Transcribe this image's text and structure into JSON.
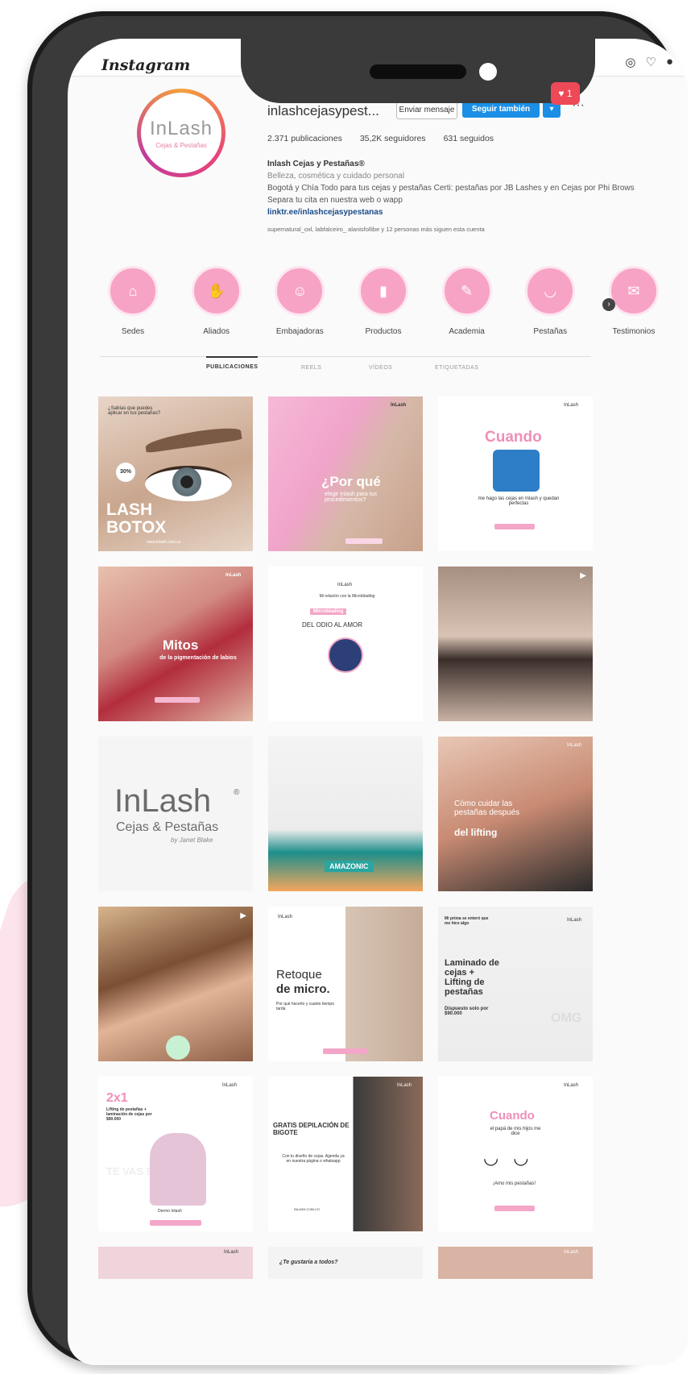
{
  "app": {
    "logo": "Instagram",
    "notification_count": "♥ 1"
  },
  "profile": {
    "avatar_logo": "InLash",
    "avatar_sub": "Cejas & Pestañas",
    "username": "inlashcejasypest...",
    "message_button": "Enviar mensaje",
    "follow_button": "Seguir también",
    "dropdown": "▾",
    "more": "···",
    "stats": {
      "posts": "2.371 publicaciones",
      "followers": "35,2K seguidores",
      "following": "631 seguidos"
    },
    "bio": {
      "name": "Inlash Cejas y Pestañas®",
      "category": "Belleza, cosmética y cuidado personal",
      "text": "Bogotá y Chía Todo para tus cejas y pestañas Certi: pestañas por JB Lashes y en Cejas por Phi Brows Separa tu cita en nuestra web o wapp",
      "link": "linktr.ee/inlashcejasypestanas",
      "followed_by": "supernatural_oxl, labfalceiro_ alanisfollibe y 12 personas más siguen esta cuenta"
    }
  },
  "highlights": [
    {
      "label": "Sedes",
      "icon": "chair-icon"
    },
    {
      "label": "Aliados",
      "icon": "handshake-icon"
    },
    {
      "label": "Embajadoras",
      "icon": "people-icon"
    },
    {
      "label": "Productos",
      "icon": "product-icon"
    },
    {
      "label": "Academia",
      "icon": "brush-icon"
    },
    {
      "label": "Pestañas",
      "icon": "lash-icon"
    },
    {
      "label": "Testimonios",
      "icon": "testimony-icon"
    }
  ],
  "tabs": [
    "PUBLICACIONES",
    "REELS",
    "VÍDEOS",
    "ETIQUETADAS"
  ],
  "posts": {
    "lash_botox": {
      "title": "LASH BOTOX",
      "top": "¿Sabías que puedes aplicar en tus pestañas?",
      "badge": "30%",
      "site": "www.inlash.com.co"
    },
    "por_que": {
      "title": "¿Por qué",
      "sub": "elegir Inlash para tus procedimientos?",
      "brand": "InLash"
    },
    "cuando1": {
      "title": "Cuando",
      "sub": "me hago las cejas en Inlash y quedan perfectas",
      "brand": "InLash"
    },
    "mitos": {
      "title": "Mitos",
      "sub": "de la pigmentación de labios",
      "brand": "InLash"
    },
    "odio": {
      "pre": "Mi relación con la Microblading",
      "tag": "Microblading",
      "title": "DEL ODIO AL AMOR",
      "brand": "InLash"
    },
    "logo": {
      "main": "InLash",
      "reg": "®",
      "sub": "Cejas & Pestañas",
      "by": "by Janet Blake"
    },
    "amazonic": {
      "title": "AMAZONIC"
    },
    "lifting": {
      "title": "Cómo cuidar las pestañas después",
      "bold": "del lifting",
      "brand": "InLash"
    },
    "retoque": {
      "title": "Retoque",
      "bold": "de micro.",
      "sub": "Por qué hacerlo y cuanto tiempo tarda",
      "brand": "InLash"
    },
    "laminado": {
      "pre": "Mi prima se enteró que me hice algo",
      "title": "Laminado de cejas + Lifting de pestañas",
      "price": "Dispuesto solo por $90.000",
      "omg": "OMG",
      "brand": "InLash"
    },
    "dos_x_uno": {
      "title": "2x1",
      "sub": "Lifting de pestañas + laminación de cejas por $90.000",
      "pattern": "TE VAS BELLA",
      "cta": "Dermo Inlash",
      "brand": "InLash"
    },
    "gratis": {
      "title": "GRATIS DEPILACIÓN DE BIGOTE",
      "sub": "Con tu diseño de cejas. Agenda ya en nuestra página o whatsapp",
      "cta": "INLASH.COM.CO",
      "brand": "InLash"
    },
    "cuando2": {
      "title": "Cuando",
      "sub": "el papá de mis hijos me dice",
      "quote": "¡Amo mis pestañas!",
      "brand": "InLash"
    },
    "row6": {
      "a": "InLash",
      "b": "¿Te gustaría a todos?",
      "c": "InLash"
    }
  }
}
